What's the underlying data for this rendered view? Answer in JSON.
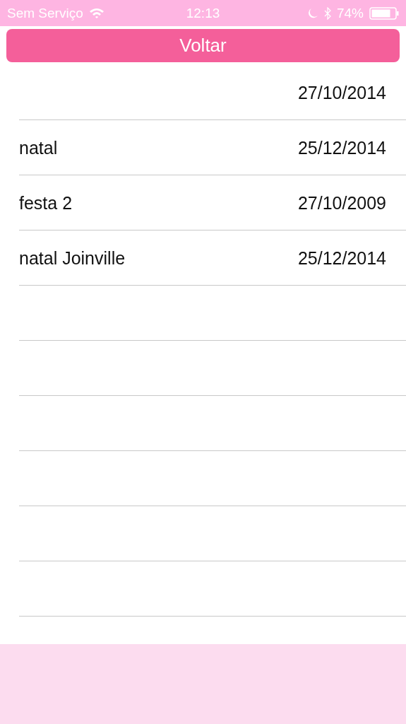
{
  "status_bar": {
    "carrier": "Sem Serviço",
    "time": "12:13",
    "battery_percent": "74%"
  },
  "back_button": {
    "label": "Voltar"
  },
  "rows": [
    {
      "date": "27/10/2014"
    },
    {
      "name": "natal",
      "date": "25/12/2014"
    },
    {
      "name": "festa 2",
      "date": "27/10/2009"
    },
    {
      "name": "natal Joinville",
      "date": "25/12/2014"
    }
  ]
}
